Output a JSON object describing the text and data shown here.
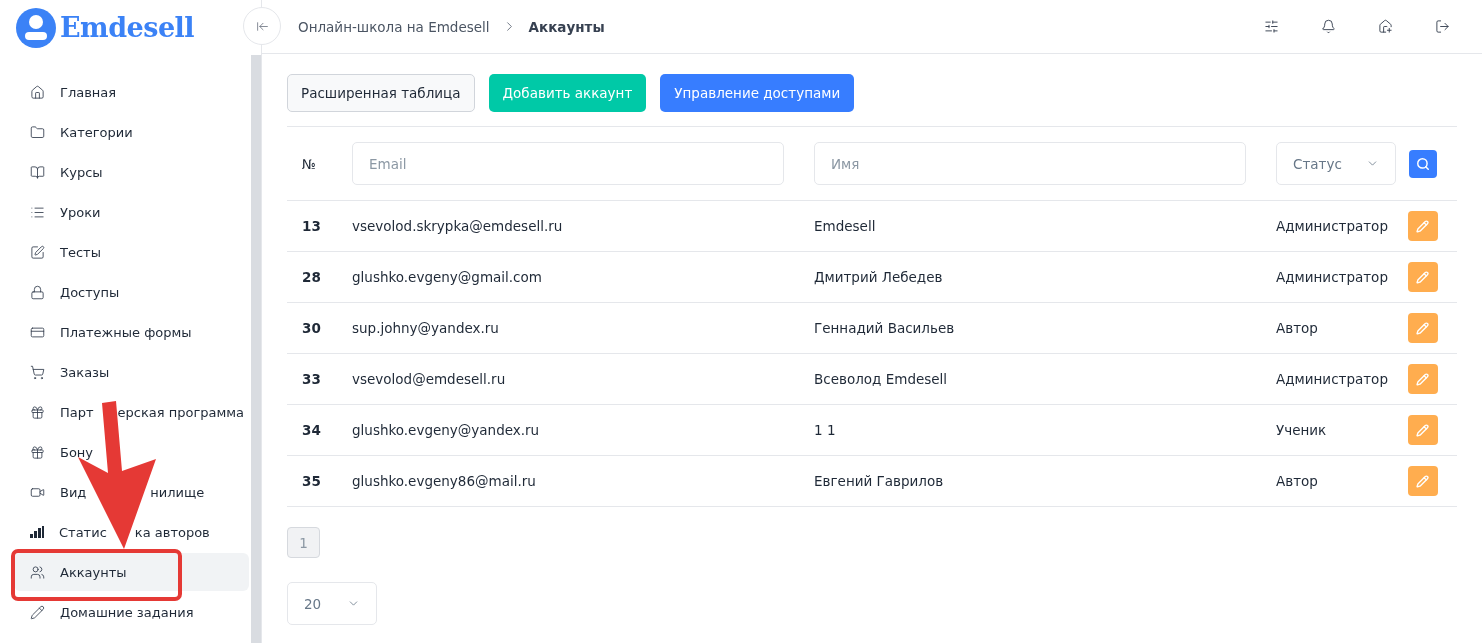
{
  "logo": {
    "text": "Emdesell"
  },
  "sidebar": {
    "items": [
      {
        "label": "Главная",
        "selected": false
      },
      {
        "label": "Категории",
        "selected": false
      },
      {
        "label": "Курсы",
        "selected": false
      },
      {
        "label": "Уроки",
        "selected": false
      },
      {
        "label": "Тесты",
        "selected": false
      },
      {
        "label": "Доступы",
        "selected": false
      },
      {
        "label": "Платежные формы",
        "selected": false
      },
      {
        "label": "Заказы",
        "selected": false
      },
      {
        "label": "Парт",
        "label_tail": "ерская программа",
        "selected": false
      },
      {
        "label": "Бону",
        "selected": false
      },
      {
        "label": "Вид",
        "label_tail": "нилище",
        "selected": false
      },
      {
        "label": "Статис",
        "label_tail": "ка авторов",
        "selected": false
      },
      {
        "label": "Аккаунты",
        "selected": true
      },
      {
        "label": "Домашние задания",
        "selected": false
      }
    ]
  },
  "breadcrumb": [
    "Онлайн-школа на Emdesell",
    "Аккаунты"
  ],
  "toolbar": {
    "buttons": [
      {
        "label": "Расширенная таблица",
        "kind": "plain"
      },
      {
        "label": "Добавить аккаунт",
        "kind": "success"
      },
      {
        "label": "Управление доступами",
        "kind": "primary"
      }
    ]
  },
  "table": {
    "number_header": "№",
    "filters": {
      "email_placeholder": "Email",
      "name_placeholder": "Имя",
      "status": "Статус"
    },
    "rows": [
      {
        "id": "13",
        "email": "vsevolod.skrypka@emdesell.ru",
        "name": "Emdesell",
        "status": "Администратор"
      },
      {
        "id": "28",
        "email": "glushko.evgeny@gmail.com",
        "name": "Дмитрий Лебедев",
        "status": "Администратор"
      },
      {
        "id": "30",
        "email": "sup.johny@yandex.ru",
        "name": "Геннадий Васильев",
        "status": "Автор"
      },
      {
        "id": "33",
        "email": "vsevolod@emdesell.ru",
        "name": "Всеволод Emdesell",
        "status": "Администратор"
      },
      {
        "id": "34",
        "email": "glushko.evgeny@yandex.ru",
        "name": "1 1",
        "status": "Ученик"
      },
      {
        "id": "35",
        "email": "glushko.evgeny86@mail.ru",
        "name": "Евгений Гаврилов",
        "status": "Автор"
      }
    ]
  },
  "pagination": {
    "pages": [
      {
        "label": "1",
        "selected": true
      }
    ],
    "page_size": "20"
  }
}
